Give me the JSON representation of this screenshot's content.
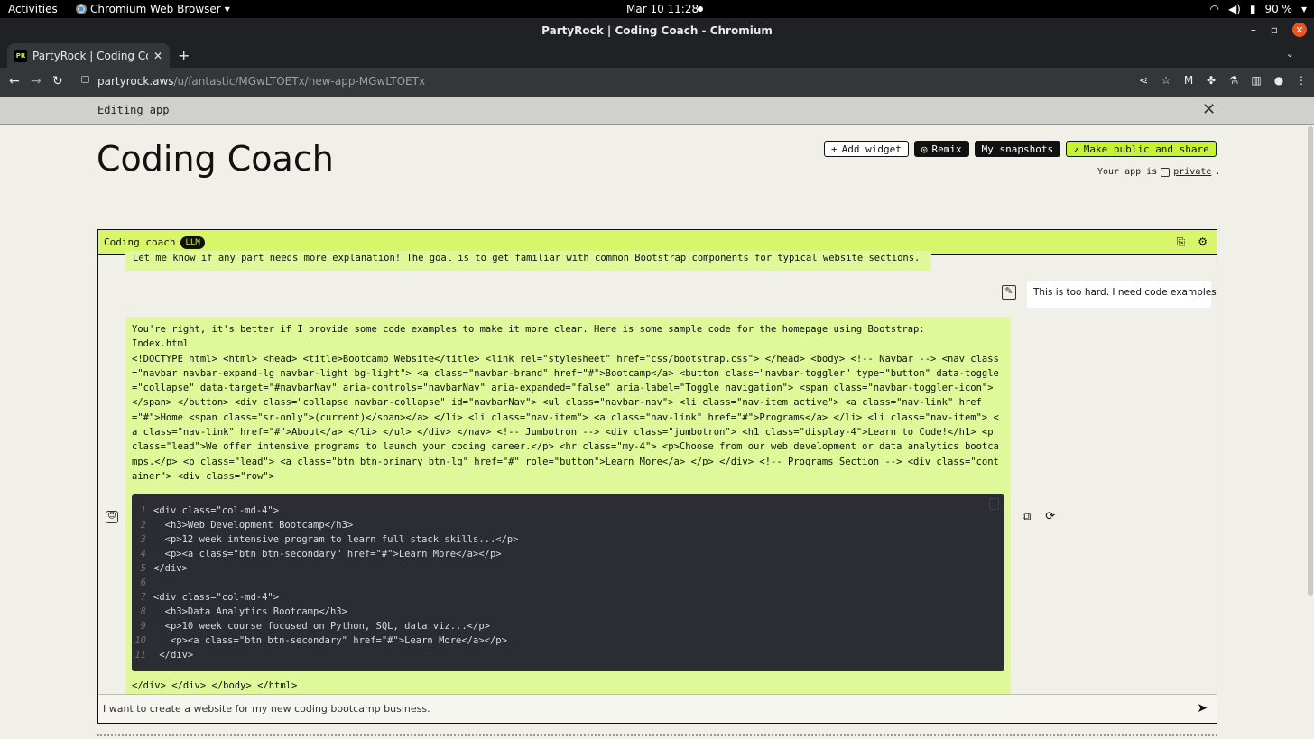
{
  "os_bar": {
    "activities": "Activities",
    "app_name": "Chromium Web Browser",
    "clock": "Mar 10  11:28",
    "battery": "90 %"
  },
  "window": {
    "title": "PartyRock | Coding Coach - Chromium"
  },
  "browser": {
    "tab_title": "PartyRock | Coding Coach",
    "tab_favicon": "PR",
    "url_host": "partyrock.aws",
    "url_path": "/u/fantastic/MGwLTOETx/new-app-MGwLTOETx"
  },
  "editing_banner": {
    "label": "Editing app"
  },
  "header": {
    "title": "Coding Coach",
    "add_widget": "Add widget",
    "remix": "Remix",
    "snapshots": "My snapshots",
    "share": "Make public and share",
    "privacy_prefix": "Your app is",
    "privacy_value": "private",
    "privacy_suffix": "."
  },
  "widget": {
    "title": "Coding coach",
    "badge": "LLM",
    "prev_message": "Let me know if any part needs more explanation! The goal is to get familiar with common Bootstrap components for typical website sections.",
    "user_message": "This is too hard. I need code examples.",
    "response_intro": "You're right, it's better if I provide some code examples to make it more clear. Here is some sample code for the homepage using Bootstrap:",
    "response_file": "Index.html",
    "response_html": "<!DOCTYPE html> <html> <head> <title>Bootcamp Website</title> <link rel=\"stylesheet\" href=\"css/bootstrap.css\"> </head> <body> <!-- Navbar --> <nav class=\"navbar navbar-expand-lg navbar-light bg-light\"> <a class=\"navbar-brand\" href=\"#\">Bootcamp</a> <button class=\"navbar-toggler\" type=\"button\" data-toggle=\"collapse\" data-target=\"#navbarNav\" aria-controls=\"navbarNav\" aria-expanded=\"false\" aria-label=\"Toggle navigation\"> <span class=\"navbar-toggler-icon\"></span> </button> <div class=\"collapse navbar-collapse\" id=\"navbarNav\"> <ul class=\"navbar-nav\"> <li class=\"nav-item active\"> <a class=\"nav-link\" href=\"#\">Home <span class=\"sr-only\">(current)</span></a> </li> <li class=\"nav-item\"> <a class=\"nav-link\" href=\"#\">Programs</a> </li> <li class=\"nav-item\"> <a class=\"nav-link\" href=\"#\">About</a> </li> </ul> </div> </nav> <!-- Jumbotron --> <div class=\"jumbotron\"> <h1 class=\"display-4\">Learn to Code!</h1> <p class=\"lead\">We offer intensive programs to launch your coding career.</p> <hr class=\"my-4\"> <p>Choose from our web development or data analytics bootcamps.</p> <p class=\"lead\"> <a class=\"btn btn-primary btn-lg\" href=\"#\" role=\"button\">Learn More</a> </p> </div> <!-- Programs Section --> <div class=\"container\"> <div class=\"row\">",
    "code_lines": [
      {
        "n": "1",
        "text": "<div class=\"col-md-4\">"
      },
      {
        "n": "2",
        "text": "  <h3>Web Development Bootcamp</h3>"
      },
      {
        "n": "3",
        "text": "  <p>12 week intensive program to learn full stack skills...</p>"
      },
      {
        "n": "4",
        "text": "  <p><a class=\"btn btn-secondary\" href=\"#\">Learn More</a></p>"
      },
      {
        "n": "5",
        "text": "</div>"
      },
      {
        "n": "6",
        "text": ""
      },
      {
        "n": "7",
        "text": "<div class=\"col-md-4\">"
      },
      {
        "n": "8",
        "text": "  <h3>Data Analytics Bootcamp</h3>"
      },
      {
        "n": "9",
        "text": "  <p>10 week course focused on Python, SQL, data viz...</p>"
      },
      {
        "n": "10",
        "text": "   <p><a class=\"btn btn-secondary\" href=\"#\">Learn More</a></p>"
      },
      {
        "n": "11",
        "text": " </div>"
      }
    ],
    "response_tail": "</div> </div> </body> </html>",
    "input_value": "I want to create a website for my new coding bootcamp business."
  },
  "colors": {
    "accent_lime": "#c6f432",
    "message_bg": "#dff99a",
    "code_bg": "#2b2d33"
  },
  "icons": [
    "wifi-icon",
    "volume-icon",
    "battery-icon",
    "share-icon",
    "star-icon",
    "extension-icon",
    "send-icon",
    "copy-icon",
    "regenerate-icon",
    "edit-icon",
    "bot-icon"
  ]
}
